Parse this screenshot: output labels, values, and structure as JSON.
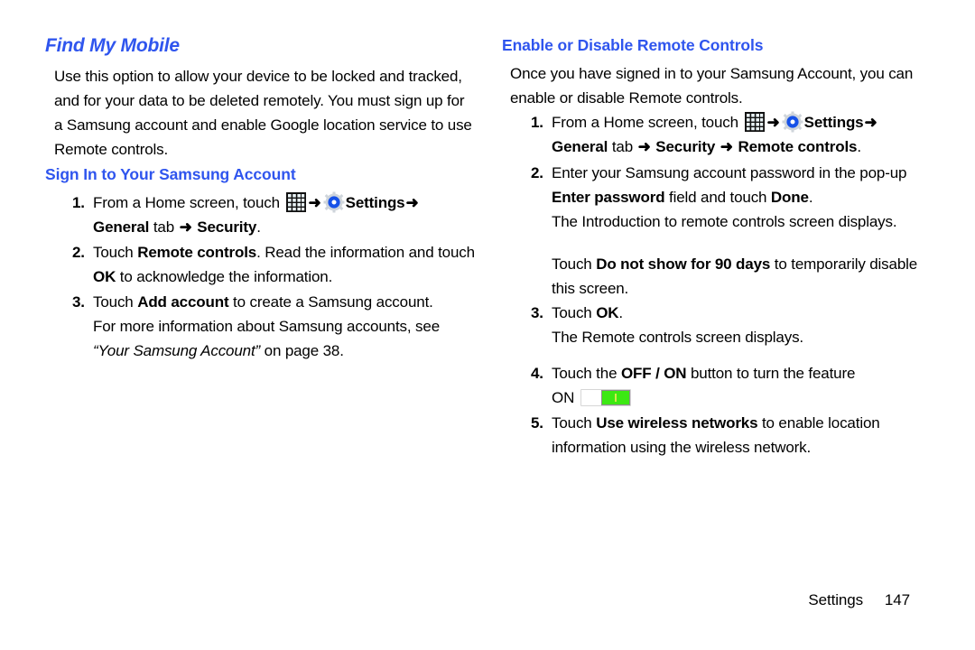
{
  "accent_color": "#2f55ee",
  "text_color": "#000000",
  "toggle_on_color": "#3ce813",
  "left_column": {
    "title": "Find My Mobile",
    "intro": "Use this option to allow your device to be locked and tracked, and for your data to be deleted remotely. You must sign up for a Samsung account and enable Google location service to use Remote controls.",
    "subsection_title": "Sign In to Your Samsung Account",
    "steps": [
      {
        "num": "1.",
        "pre_apps": "From a Home screen, touch ",
        "apps_icon": "apps-grid-icon",
        "arrow1": "➜",
        "gear_icon": "settings-gear-icon",
        "settings_label": "Settings",
        "arrow2": "➜",
        "general_label": "General",
        "tab_word": " tab ",
        "arrow3": "➜",
        "security_label": "Security",
        "period": "."
      },
      {
        "num": "2.",
        "a": "Touch ",
        "b1": "Remote controls",
        "c": ". Read the information and touch ",
        "b2": "OK",
        "d": " to acknowledge the information."
      },
      {
        "num": "3.",
        "a": "Touch ",
        "b1": "Add account",
        "c": " to create a Samsung account.",
        "sub1": "For more information about Samsung accounts, see ",
        "sub_italic": "“Your Samsung Account”",
        "sub2": " on page 38."
      }
    ]
  },
  "right_column": {
    "title": "Enable or Disable Remote Controls",
    "intro": "Once you have signed in to your Samsung Account, you can enable or disable Remote controls.",
    "steps": [
      {
        "num": "1.",
        "pre_apps": "From a Home screen, touch ",
        "apps_icon": "apps-grid-icon",
        "arrow1": "➜",
        "gear_icon": "settings-gear-icon",
        "settings_label": "Settings",
        "arrow2": "➜",
        "general_label": "General",
        "tab_word": " tab ",
        "arrow3": "➜",
        "security_label": "Security",
        "arrow4": "➜",
        "remote_label": "Remote controls",
        "period": "."
      },
      {
        "num": "2.",
        "a": "Enter your Samsung account password in the pop-up ",
        "b1": "Enter password",
        "c": " field and touch ",
        "b2": "Done",
        "d": ".",
        "sub1": "The Introduction to remote controls screen displays.",
        "sub2_a": "Touch ",
        "sub2_b": "Do not show for 90 days",
        "sub2_c": " to temporarily disable this screen."
      },
      {
        "num": "3.",
        "a": "Touch ",
        "b1": "OK",
        "c": ".",
        "sub1": "The Remote controls screen displays."
      },
      {
        "num": "4.",
        "a": "Touch the ",
        "b1": "OFF / ON",
        "c": " button to turn the feature",
        "on_label": "ON",
        "toggle_state": "on"
      },
      {
        "num": "5.",
        "a": "Touch ",
        "b1": "Use wireless networks",
        "c": " to enable location information using the wireless network."
      }
    ]
  },
  "footer": {
    "label": "Settings",
    "page_number": "147"
  }
}
